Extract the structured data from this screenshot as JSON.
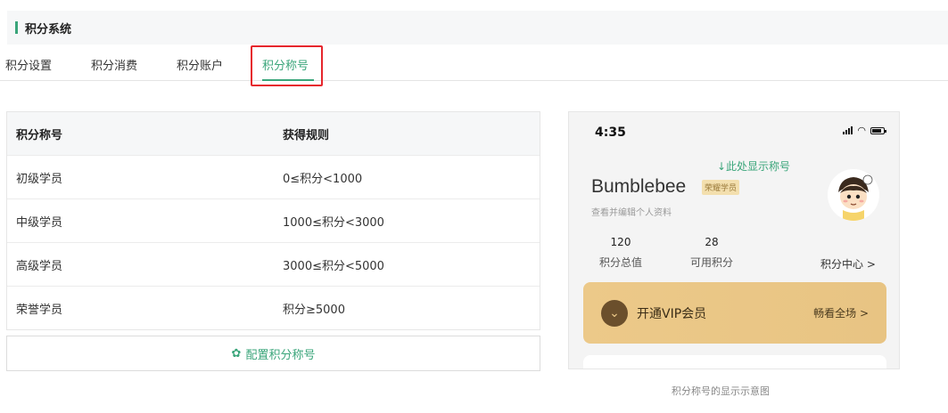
{
  "section": {
    "title": "积分系统"
  },
  "tabs": [
    {
      "label": "积分设置"
    },
    {
      "label": "积分消费"
    },
    {
      "label": "积分账户"
    },
    {
      "label": "积分称号",
      "active": true
    }
  ],
  "table": {
    "headers": [
      "积分称号",
      "获得规则"
    ],
    "rows": [
      {
        "title": "初级学员",
        "rule": "0≤积分<1000"
      },
      {
        "title": "中级学员",
        "rule": "1000≤积分<3000"
      },
      {
        "title": "高级学员",
        "rule": "3000≤积分<5000"
      },
      {
        "title": "荣誉学员",
        "rule": "积分≥5000"
      }
    ]
  },
  "config_button": {
    "label": "配置积分称号",
    "icon": "gear-icon"
  },
  "preview": {
    "time": "4:35",
    "annotation": "↓此处显示称号",
    "username": "Bumblebee",
    "rank_badge": "荣耀学员",
    "edit_profile": "查看并编辑个人资料",
    "stats": [
      {
        "value": "120",
        "label": "积分总值"
      },
      {
        "value": "28",
        "label": "可用积分"
      }
    ],
    "points_center": "积分中心 >",
    "vip": {
      "label": "开通VIP会员",
      "action": "畅看全场 >"
    },
    "caption": "积分称号的显示示意图"
  },
  "colors": {
    "accent": "#3aa57a",
    "highlight": "#e6262d",
    "vip_gold": "#ecc989"
  }
}
